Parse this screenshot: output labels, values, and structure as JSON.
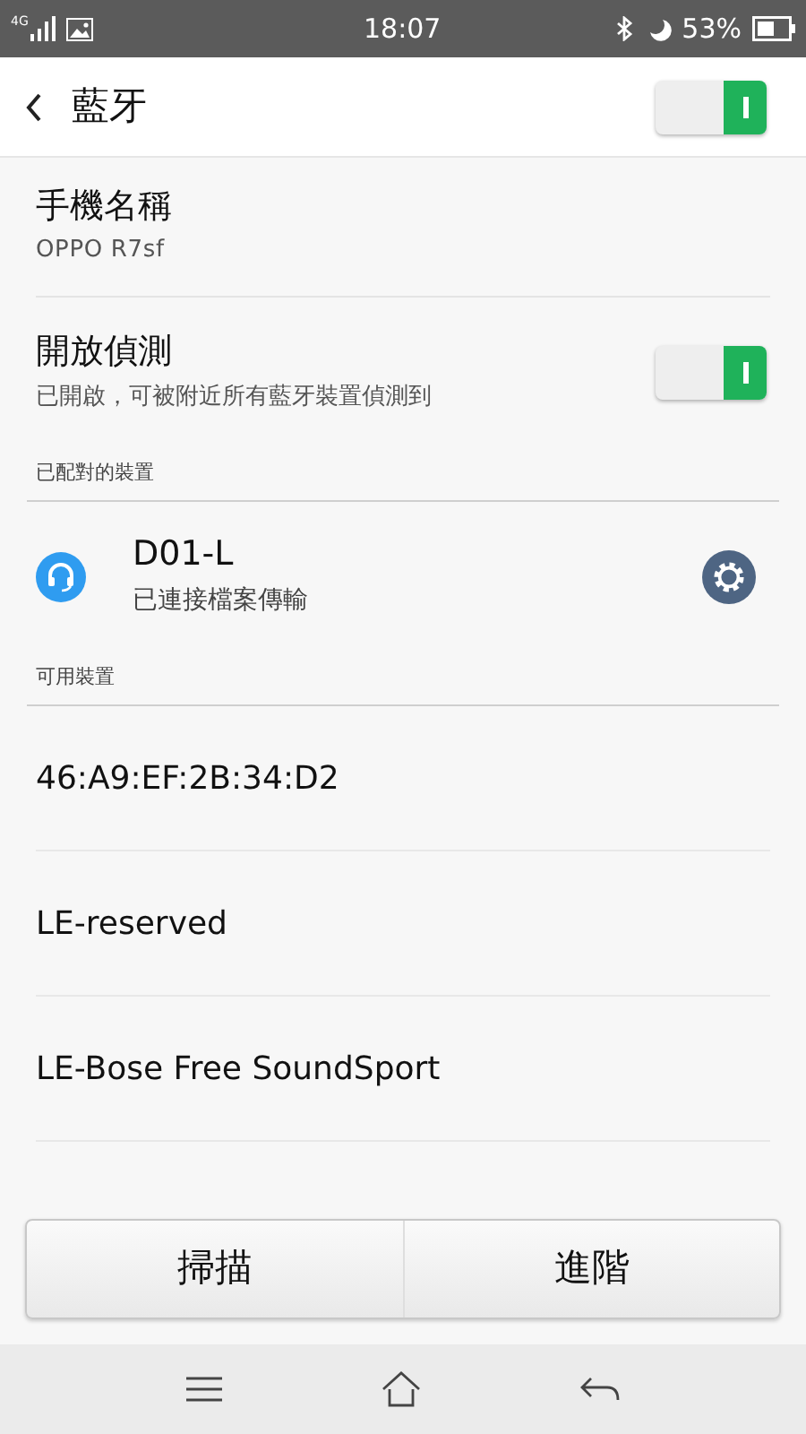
{
  "status_bar": {
    "network": "4G",
    "time": "18:07",
    "battery": "53%"
  },
  "header": {
    "title": "藍牙",
    "on": true
  },
  "device_name": {
    "label": "手機名稱",
    "value": "OPPO R7sf"
  },
  "discovery": {
    "label": "開放偵測",
    "description": "已開啟，可被附近所有藍牙裝置偵測到",
    "on": true
  },
  "paired_section": {
    "title": "已配對的裝置"
  },
  "paired_devices": [
    {
      "name": "D01-L",
      "status": "已連接檔案傳輸"
    }
  ],
  "available_section": {
    "title": "可用裝置"
  },
  "available_devices": [
    {
      "name": "46:A9:EF:2B:34:D2"
    },
    {
      "name": "LE-reserved"
    },
    {
      "name": "LE-Bose Free SoundSport"
    }
  ],
  "buttons": [
    "掃描",
    "進階"
  ]
}
